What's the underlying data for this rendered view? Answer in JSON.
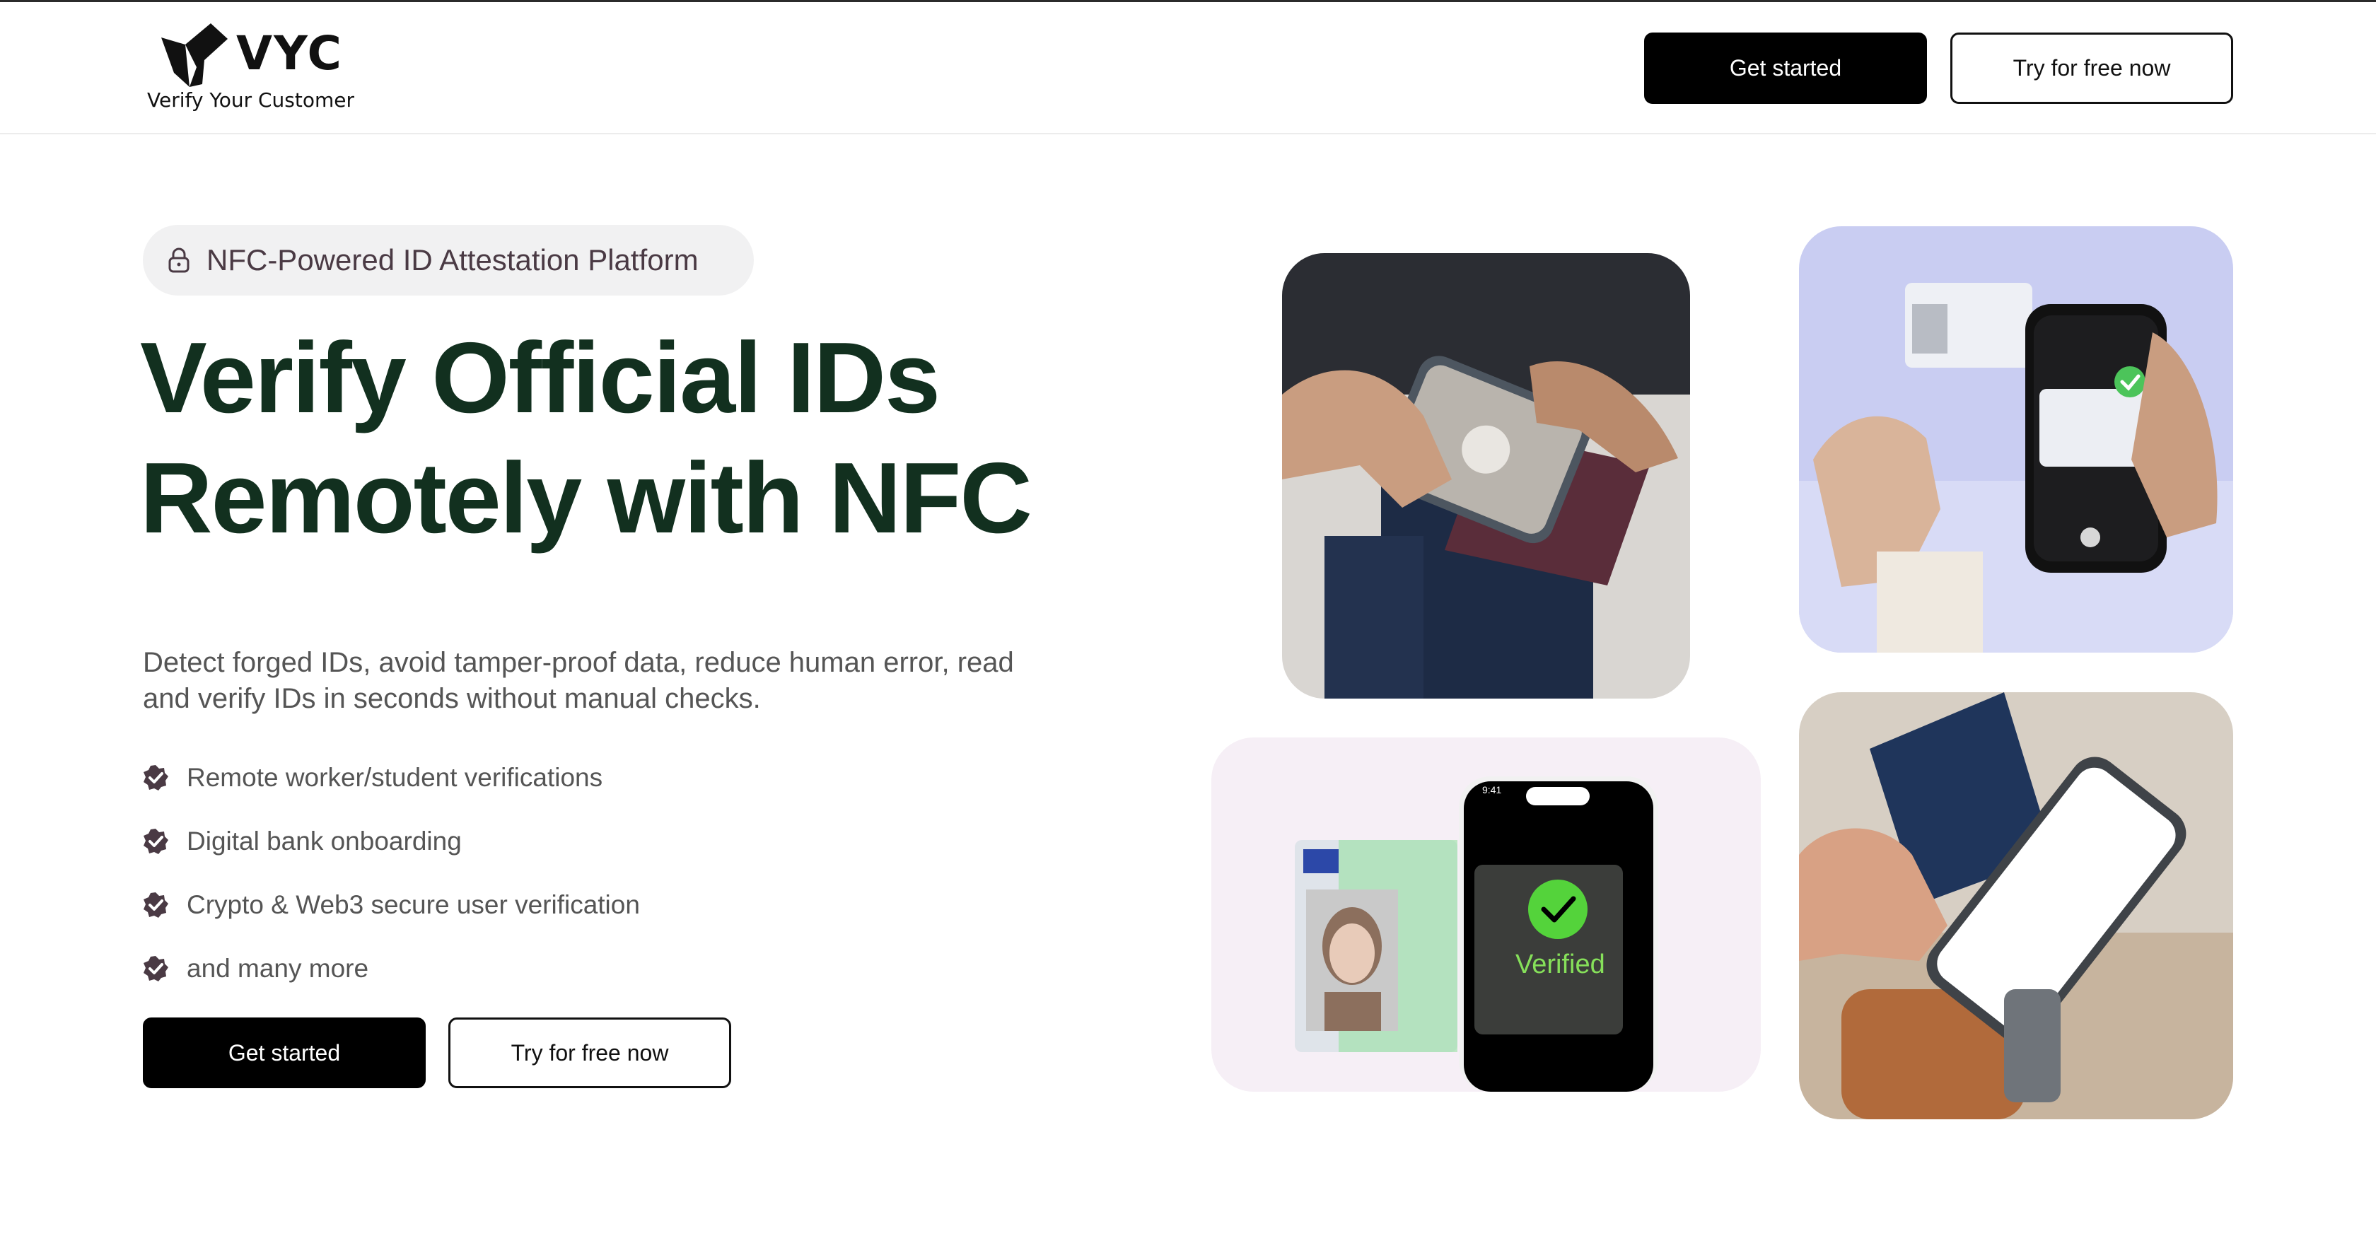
{
  "brand": {
    "name": "VYC",
    "tagline": "Verify Your Customer"
  },
  "header": {
    "get_started": "Get started",
    "try_free": "Try for free now"
  },
  "hero": {
    "badge": "NFC-Powered ID Attestation Platform",
    "headline_line1": "Verify Official IDs",
    "headline_line2": "Remotely with NFC",
    "description": "Detect forged IDs, avoid tamper-proof data, reduce human error, read and verify IDs in seconds without manual checks.",
    "features": [
      "Remote worker/student verifications",
      "Digital bank onboarding",
      "Crypto & Web3 secure user verification",
      "and many more"
    ],
    "get_started": "Get started",
    "try_free": "Try for free now"
  },
  "images": {
    "verified_label": "Verified",
    "phone_time": "9:41"
  },
  "colors": {
    "headline": "#12301f",
    "check_badge": "#4a3a44",
    "verified_green": "#86e05a"
  },
  "icons": [
    "lock-icon",
    "check-badge-icon",
    "checkmark-icon"
  ]
}
